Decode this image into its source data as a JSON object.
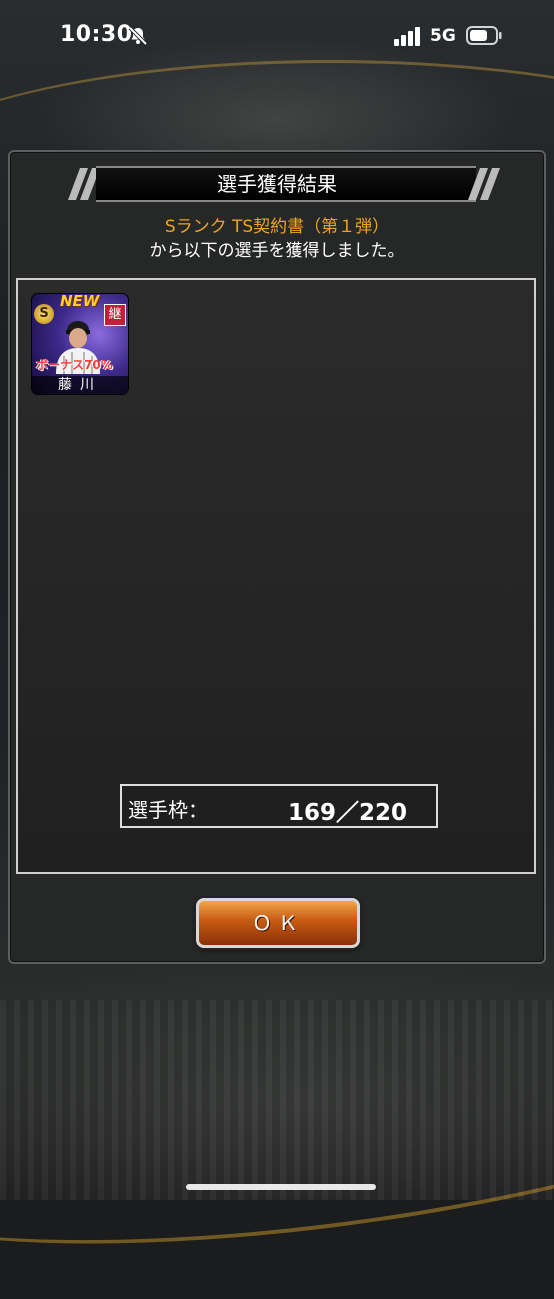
{
  "status_bar": {
    "time": "10:30",
    "network": "5G"
  },
  "dialog": {
    "title": "選手獲得結果",
    "source_item": "Sランク TS契約書（第１弾）",
    "message": "から以下の選手を獲得しました。",
    "player_card": {
      "new_badge": "NEW",
      "rank": "S",
      "succession_badge": "継",
      "bonus": "ボーナス70%",
      "name": "藤川"
    },
    "slots": {
      "label": "選手枠：",
      "value": "169／220"
    },
    "ok_label": "ＯＫ"
  },
  "colors": {
    "accent_orange": "#f0a51f",
    "button_orange": "#c65a12",
    "badge_red": "#c0213a"
  }
}
